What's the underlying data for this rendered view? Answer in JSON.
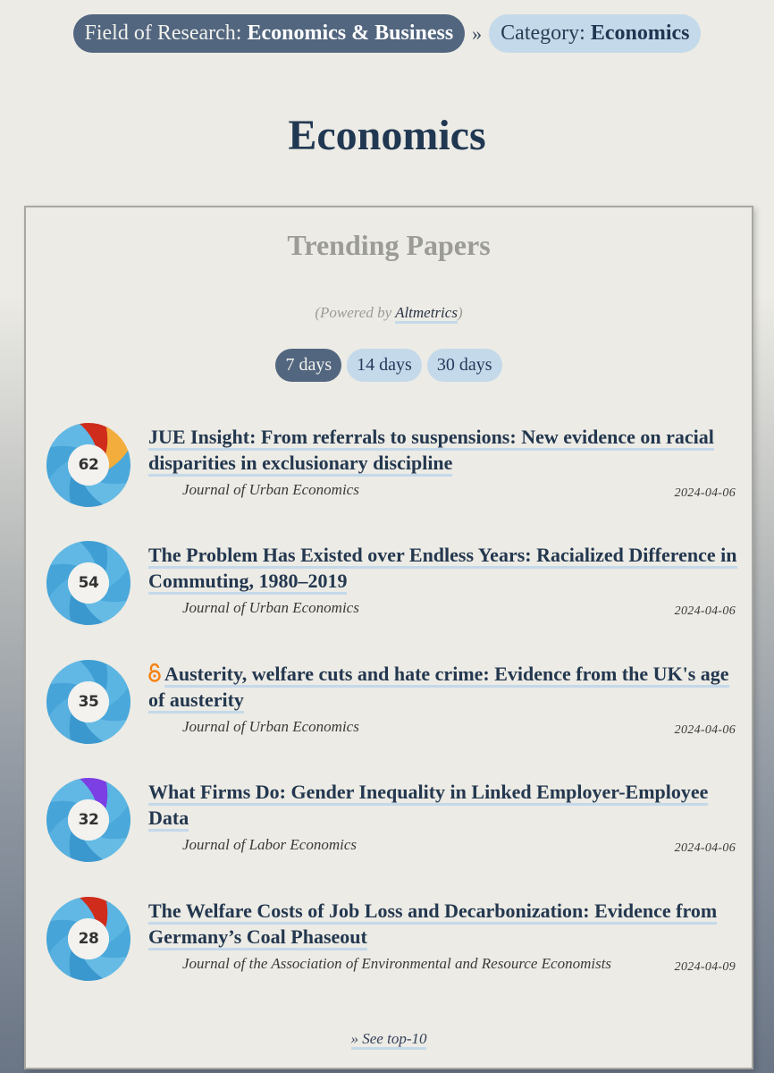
{
  "breadcrumb": {
    "field_prefix": "Field of Research: ",
    "field_value": "Economics & Business",
    "separator": "»",
    "category_prefix": "Category: ",
    "category_value": "Economics"
  },
  "page_title": "Economics",
  "trending": {
    "title": "Trending Papers",
    "powered_prefix": "(Powered by ",
    "powered_link": "Altmetrics",
    "powered_suffix": ")",
    "tabs": [
      {
        "label": "7 days",
        "active": true
      },
      {
        "label": "14 days",
        "active": false
      },
      {
        "label": "30 days",
        "active": false
      }
    ],
    "papers": [
      {
        "score": "62",
        "title": "JUE Insight: From referrals to suspensions: New evidence on racial disparities in exclusionary discipline",
        "journal": "Journal of Urban Economics",
        "date": "2024-04-06",
        "open_access": false,
        "donut_colors": [
          "#cf2c1c",
          "#f3ad3c"
        ]
      },
      {
        "score": "54",
        "title": "The Problem Has Existed over Endless Years: Racialized Difference in Commuting, 1980–2019",
        "journal": "Journal of Urban Economics",
        "date": "2024-04-06",
        "open_access": false,
        "donut_colors": []
      },
      {
        "score": "35",
        "title": "Austerity, welfare cuts and hate crime: Evidence from the UK's age of austerity",
        "journal": "Journal of Urban Economics",
        "date": "2024-04-06",
        "open_access": true,
        "donut_colors": []
      },
      {
        "score": "32",
        "title": "What Firms Do: Gender Inequality in Linked Employer-Employee Data",
        "journal": "Journal of Labor Economics",
        "date": "2024-04-06",
        "open_access": false,
        "donut_colors": [
          "#7b3fe4"
        ]
      },
      {
        "score": "28",
        "title": "The Welfare Costs of Job Loss and Decarbonization: Evidence from Germany’s Coal Phaseout",
        "journal": "Journal of the Association of Environmental and Resource Economists",
        "date": "2024-04-09",
        "open_access": false,
        "donut_colors": [
          "#cf2c1c"
        ]
      }
    ],
    "see_more": "» See top-10"
  },
  "colors": {
    "breadcrumb_dark": "#52667f",
    "breadcrumb_light": "#c4d9ea",
    "title": "#213852",
    "donut_blue": "#4ba9da",
    "open_access": "#f68212"
  }
}
